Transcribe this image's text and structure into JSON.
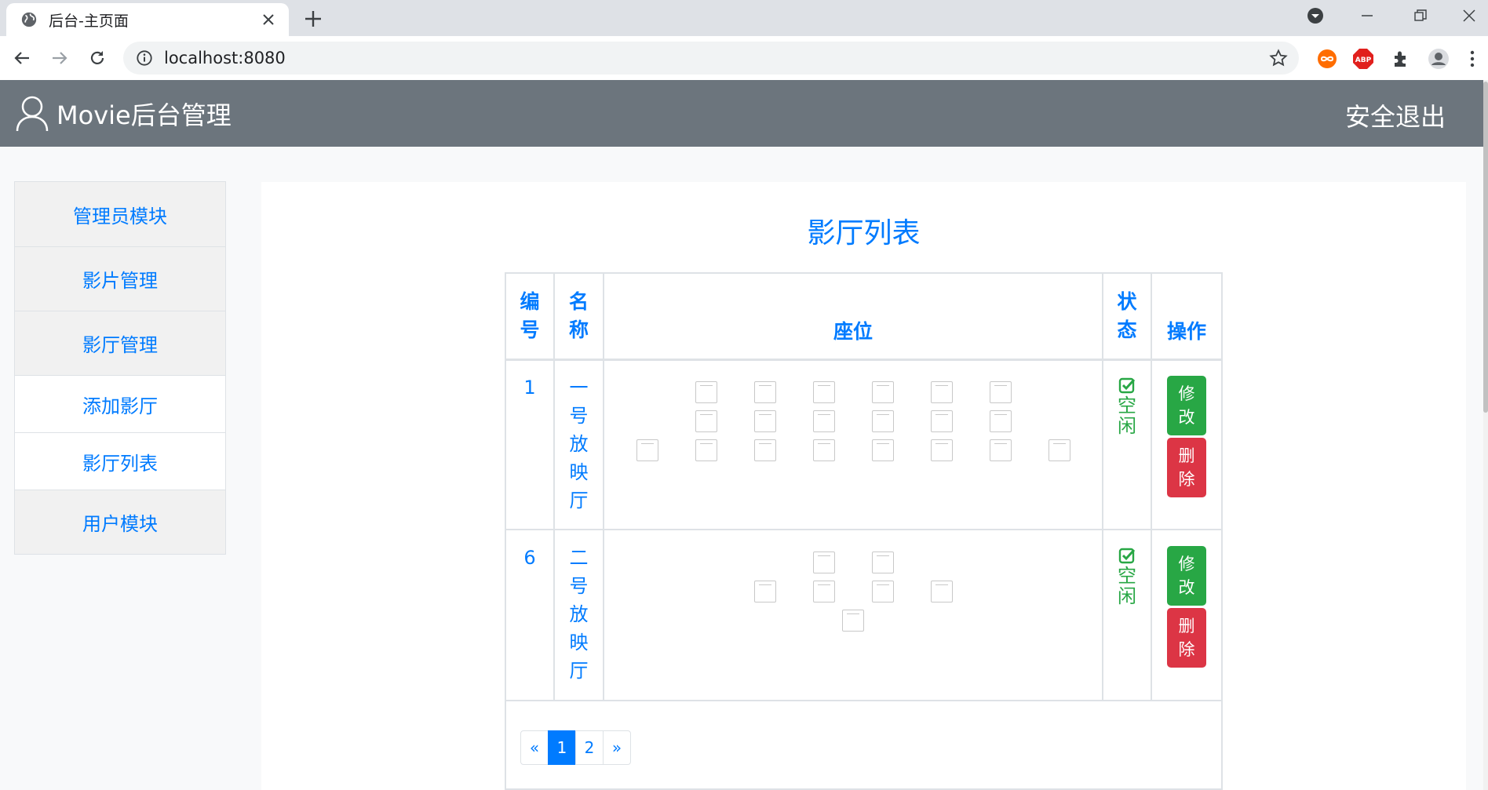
{
  "browser": {
    "tab_title": "后台-主页面",
    "url": "localhost:8080"
  },
  "header": {
    "brand": "Movie后台管理",
    "logout": "安全退出"
  },
  "sidebar": {
    "items": [
      {
        "label": "管理员模块"
      },
      {
        "label": "影片管理"
      },
      {
        "label": "影厅管理"
      },
      {
        "label": "添加影厅"
      },
      {
        "label": "影厅列表"
      },
      {
        "label": "用户模块"
      }
    ]
  },
  "main": {
    "title": "影厅列表",
    "columns": {
      "id": "编号",
      "name": "名称",
      "seats": "座位",
      "status": "状态",
      "actions": "操作"
    },
    "rows": [
      {
        "id": "1",
        "name": "一号放映厅",
        "status": "空闲",
        "edit_label": "修改",
        "delete_label": "删除",
        "seat_rows": [
          6,
          6,
          8
        ]
      },
      {
        "id": "6",
        "name": "二号放映厅",
        "status": "空闲",
        "edit_label": "修改",
        "delete_label": "删除",
        "seat_rows": [
          2,
          4,
          1
        ]
      }
    ],
    "pagination": {
      "prev": "«",
      "pages": [
        "1",
        "2"
      ],
      "current": "1",
      "next": "»"
    }
  },
  "colors": {
    "header_bg": "#6c757d",
    "accent": "#007bff",
    "success": "#28a745",
    "danger": "#dc3545"
  }
}
